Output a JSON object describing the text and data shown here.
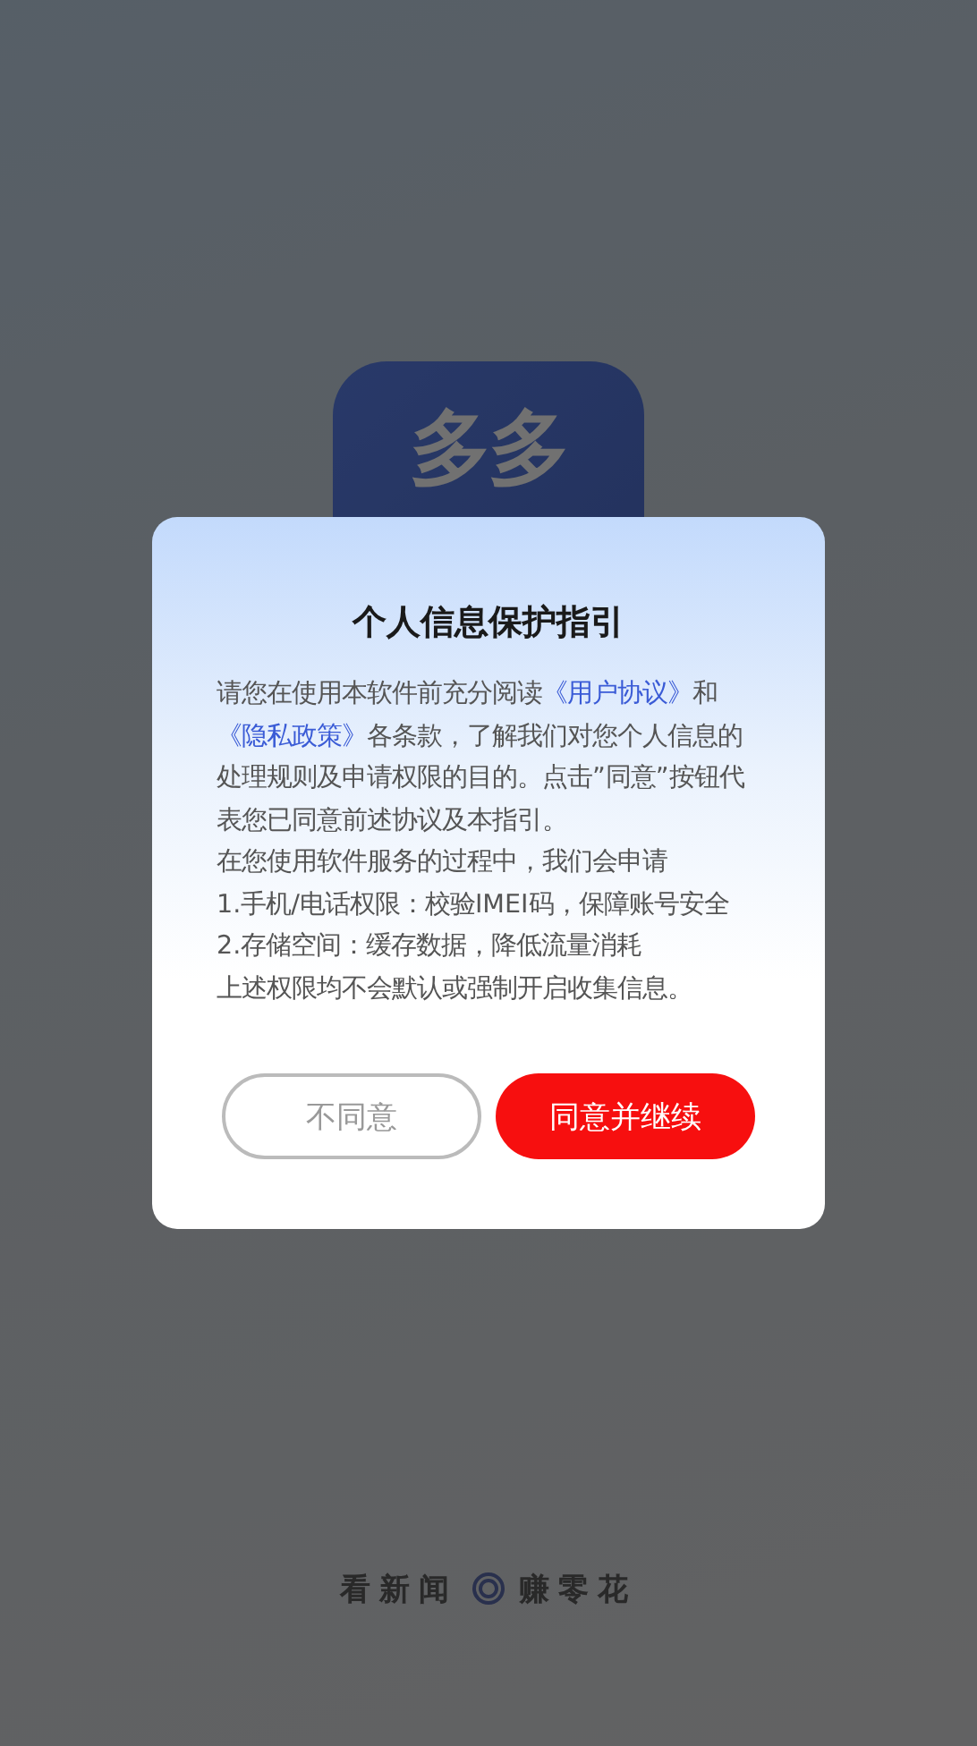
{
  "app_icon": {
    "text": "多多"
  },
  "dialog": {
    "title": "个人信息保护指引",
    "intro": [
      {
        "kind": "text",
        "text": "请您在使用本软件前充分阅读"
      },
      {
        "kind": "link",
        "text": "《用户协议》"
      },
      {
        "kind": "text",
        "text": "和"
      },
      {
        "kind": "link",
        "text": "《隐私政策》"
      },
      {
        "kind": "text",
        "text": "各条款，了解我们对您个人信息的处理规则及申请权限的目的。点击”同意”按钮代表您已同意前述协议及本指引。"
      }
    ],
    "lines": [
      "在您使用软件服务的过程中，我们会申请",
      "1.手机/电话权限：校验IMEI码，保障账号安全",
      "2.存储空间：缓存数据，降低流量消耗",
      "上述权限均不会默认或强制开启收集信息。"
    ],
    "buttons": [
      {
        "kind": "secondary",
        "label": "不同意"
      },
      {
        "kind": "primary",
        "label": "同意并继续"
      }
    ]
  },
  "footer": {
    "left": "看新闻",
    "right": "赚零花"
  }
}
